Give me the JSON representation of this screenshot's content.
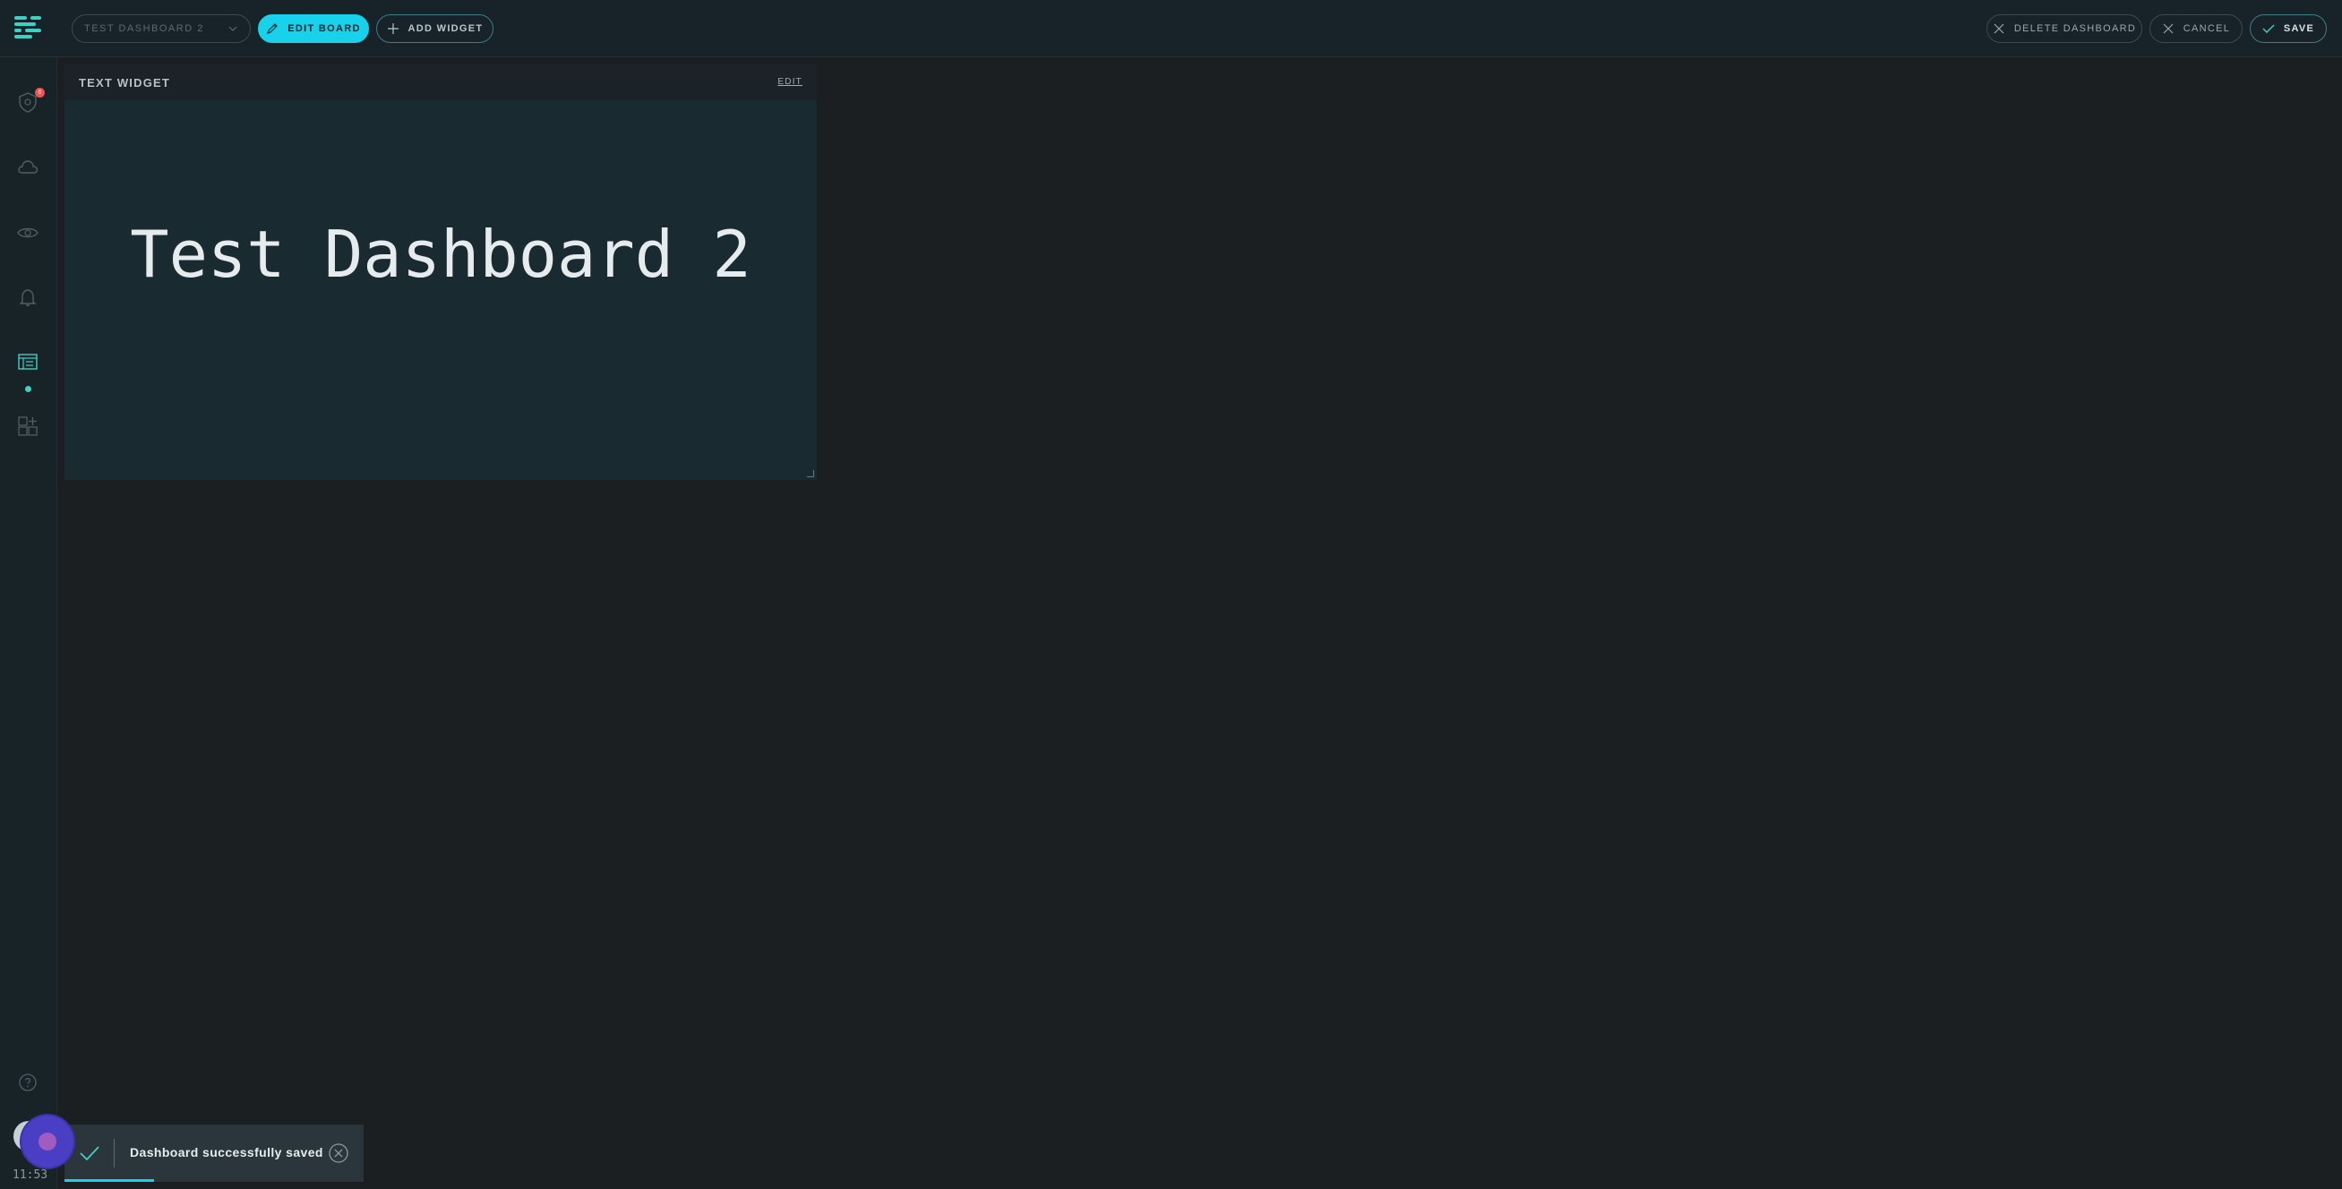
{
  "toolbar": {
    "dashboard_select": "TEST DASHBOARD 2",
    "edit_board": "EDIT BOARD",
    "add_widget": "ADD WIDGET",
    "delete_dashboard": "DELETE DASHBOARD",
    "cancel": "CANCEL",
    "save": "SAVE"
  },
  "sidebar": {
    "badge_count": "6",
    "items": [
      {
        "icon": "shield-icon"
      },
      {
        "icon": "cloud-icon"
      },
      {
        "icon": "eye-network-icon"
      },
      {
        "icon": "bell-icon"
      },
      {
        "icon": "dashboard-icon"
      },
      {
        "icon": "widgets-icon"
      }
    ],
    "clock": "11:53"
  },
  "widget": {
    "title": "TEXT WIDGET",
    "edit": "EDIT",
    "text": "Test Dashboard 2"
  },
  "toast": {
    "message": "Dashboard successfully saved",
    "progress": 0.3
  },
  "colors": {
    "accent": "#17d2ea",
    "teal": "#3fd0c4",
    "background": "#1b1f22"
  }
}
